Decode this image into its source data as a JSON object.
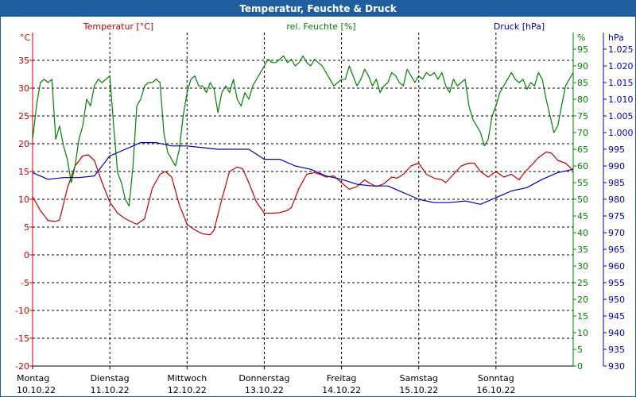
{
  "window": {
    "title": "Temperatur, Feuchte & Druck"
  },
  "colors": {
    "temperature": "#c00000",
    "humidity": "#008000",
    "pressure": "#0000b0",
    "grid": "#000000",
    "titlebar": "#1f5f9f"
  },
  "chart_data": {
    "type": "line",
    "title": "Temperatur, Feuchte & Druck",
    "axes": {
      "temperature": {
        "label": "Temperatur [°C]",
        "unit_label": "°C",
        "range": [
          -20,
          40
        ],
        "ticks": [
          35,
          30,
          25,
          20,
          15,
          10,
          5,
          0,
          -5,
          -10,
          -15,
          -20
        ]
      },
      "humidity": {
        "label": "rel. Feuchte [%]",
        "unit_label": "%",
        "range": [
          0,
          100
        ],
        "ticks": [
          95,
          90,
          85,
          80,
          75,
          70,
          65,
          60,
          55,
          50,
          45,
          40,
          35,
          30,
          25,
          20,
          15,
          10,
          5,
          0
        ]
      },
      "pressure": {
        "label": "Druck [hPa]",
        "unit_label": "hPa",
        "range": [
          930,
          1030
        ],
        "ticks": [
          "1.025",
          "1.020",
          "1.015",
          "1.010",
          "1.005",
          "1.000",
          "995",
          "990",
          "985",
          "980",
          "975",
          "970",
          "965",
          "960",
          "955",
          "950",
          "945",
          "940",
          "935",
          "930"
        ]
      }
    },
    "days": [
      {
        "name": "Montag",
        "date": "10.10.22"
      },
      {
        "name": "Dienstag",
        "date": "11.10.22"
      },
      {
        "name": "Mittwoch",
        "date": "12.10.22"
      },
      {
        "name": "Donnerstag",
        "date": "13.10.22"
      },
      {
        "name": "Freitag",
        "date": "14.10.22"
      },
      {
        "name": "Samstag",
        "date": "15.10.22"
      },
      {
        "name": "Sonntag",
        "date": "16.10.22"
      }
    ],
    "x_range": [
      0,
      7
    ],
    "grid": true,
    "series": [
      {
        "name": "Temperatur [°C]",
        "axis": "temperature",
        "x": [
          0,
          0.1,
          0.2,
          0.3,
          0.35,
          0.45,
          0.55,
          0.65,
          0.72,
          0.8,
          0.9,
          1.0,
          1.1,
          1.2,
          1.3,
          1.35,
          1.45,
          1.55,
          1.65,
          1.72,
          1.8,
          1.9,
          2.0,
          2.1,
          2.2,
          2.3,
          2.35,
          2.45,
          2.55,
          2.65,
          2.72,
          2.8,
          2.9,
          3.0,
          3.1,
          3.2,
          3.3,
          3.35,
          3.45,
          3.55,
          3.65,
          3.72,
          3.8,
          3.9,
          4.0,
          4.1,
          4.2,
          4.3,
          4.35,
          4.45,
          4.55,
          4.65,
          4.72,
          4.8,
          4.9,
          5.0,
          5.1,
          5.2,
          5.3,
          5.35,
          5.45,
          5.55,
          5.65,
          5.72,
          5.8,
          5.9,
          6.0,
          6.1,
          6.2,
          6.3,
          6.35,
          6.45,
          6.55,
          6.65,
          6.72,
          6.8,
          6.9,
          7.0
        ],
        "y": [
          10.5,
          8,
          6.2,
          6.0,
          6.3,
          12,
          16,
          17.8,
          18,
          17,
          13,
          9.5,
          7.5,
          6.5,
          5.8,
          5.5,
          6.5,
          12,
          14.5,
          15,
          14,
          9,
          5.5,
          4.5,
          3.8,
          3.6,
          4.5,
          10,
          15,
          15.8,
          15.5,
          13,
          9.5,
          7.5,
          7.5,
          7.6,
          8,
          8.5,
          12,
          14.5,
          14.8,
          14.5,
          14,
          14.2,
          13,
          11.8,
          12.3,
          13.5,
          13,
          12.3,
          12.8,
          14,
          13.8,
          14.5,
          16,
          16.5,
          14.5,
          13.8,
          13.5,
          13,
          14.5,
          16,
          16.5,
          16.5,
          15,
          14,
          15,
          14,
          14.5,
          13.5,
          14.5,
          16,
          17.5,
          18.5,
          18.3,
          17,
          16.5,
          15.2
        ]
      },
      {
        "name": "rel. Feuchte [%]",
        "axis": "humidity",
        "x": [
          0,
          0.05,
          0.1,
          0.15,
          0.2,
          0.25,
          0.3,
          0.35,
          0.4,
          0.45,
          0.5,
          0.55,
          0.6,
          0.65,
          0.7,
          0.75,
          0.8,
          0.85,
          0.9,
          0.95,
          1.0,
          1.05,
          1.1,
          1.15,
          1.2,
          1.25,
          1.3,
          1.35,
          1.4,
          1.45,
          1.5,
          1.55,
          1.6,
          1.65,
          1.7,
          1.75,
          1.8,
          1.85,
          1.9,
          1.95,
          2.0,
          2.05,
          2.1,
          2.15,
          2.2,
          2.25,
          2.3,
          2.35,
          2.4,
          2.45,
          2.5,
          2.55,
          2.6,
          2.65,
          2.7,
          2.75,
          2.8,
          2.85,
          2.9,
          2.95,
          3.0,
          3.05,
          3.1,
          3.15,
          3.2,
          3.25,
          3.3,
          3.35,
          3.4,
          3.45,
          3.5,
          3.55,
          3.6,
          3.65,
          3.7,
          3.75,
          3.8,
          3.85,
          3.9,
          3.95,
          4.0,
          4.05,
          4.1,
          4.15,
          4.2,
          4.25,
          4.3,
          4.35,
          4.4,
          4.45,
          4.5,
          4.55,
          4.6,
          4.65,
          4.7,
          4.75,
          4.8,
          4.85,
          4.9,
          4.95,
          5.0,
          5.05,
          5.1,
          5.15,
          5.2,
          5.25,
          5.3,
          5.35,
          5.4,
          5.45,
          5.5,
          5.55,
          5.6,
          5.65,
          5.7,
          5.75,
          5.8,
          5.85,
          5.9,
          5.95,
          6.0,
          6.05,
          6.1,
          6.15,
          6.2,
          6.25,
          6.3,
          6.35,
          6.4,
          6.45,
          6.5,
          6.55,
          6.6,
          6.65,
          6.7,
          6.75,
          6.8,
          6.85,
          6.9,
          6.95,
          7.0
        ],
        "y": [
          68,
          78,
          85,
          86,
          85,
          86,
          68,
          72,
          66,
          62,
          55,
          60,
          68,
          72,
          80,
          78,
          84,
          86,
          85,
          86,
          87,
          72,
          58,
          55,
          50,
          48,
          60,
          78,
          80,
          84,
          85,
          85,
          86,
          85,
          70,
          64,
          62,
          60,
          65,
          75,
          82,
          86,
          87,
          84,
          84,
          82,
          85,
          83,
          76,
          82,
          84,
          82,
          86,
          80,
          78,
          82,
          80,
          84,
          86,
          88,
          90,
          92,
          91,
          91,
          92,
          93,
          91,
          92,
          90,
          91,
          93,
          91,
          90,
          92,
          91,
          90,
          88,
          86,
          84,
          85,
          86,
          86,
          90,
          87,
          84,
          86,
          89,
          87,
          84,
          86,
          82,
          84,
          85,
          88,
          87,
          85,
          84,
          89,
          87,
          85,
          87,
          86,
          88,
          87,
          88,
          86,
          88,
          84,
          82,
          86,
          84,
          85,
          86,
          78,
          74,
          72,
          70,
          66,
          68,
          75,
          78,
          82,
          84,
          86,
          88,
          86,
          85,
          86,
          83,
          85,
          84,
          88,
          86,
          80,
          75,
          70,
          72,
          78,
          84,
          86,
          88
        ]
      },
      {
        "name": "Druck [hPa]",
        "axis": "pressure",
        "x": [
          0,
          0.2,
          0.4,
          0.6,
          0.8,
          1.0,
          1.2,
          1.4,
          1.6,
          1.8,
          2.0,
          2.2,
          2.4,
          2.6,
          2.8,
          3.0,
          3.2,
          3.4,
          3.6,
          3.8,
          4.0,
          4.2,
          4.4,
          4.6,
          4.8,
          5.0,
          5.2,
          5.4,
          5.6,
          5.8,
          6.0,
          6.2,
          6.4,
          6.6,
          6.8,
          7.0
        ],
        "y": [
          988,
          986,
          986.5,
          986.5,
          987,
          993,
          995,
          997,
          997,
          996,
          996,
          995.5,
          995,
          995,
          995,
          992,
          992,
          990,
          989,
          987,
          986,
          984.5,
          984,
          984,
          982,
          980,
          979,
          979,
          979.5,
          978.5,
          980.5,
          982.5,
          983.5,
          986,
          988,
          989
        ]
      }
    ]
  }
}
